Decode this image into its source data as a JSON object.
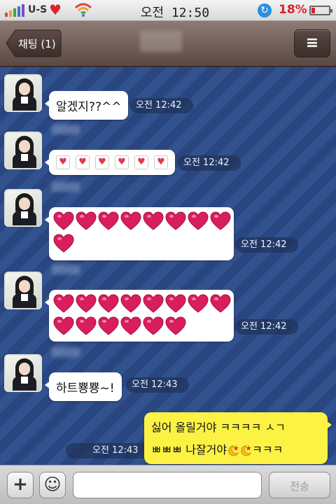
{
  "status_bar": {
    "carrier": "U-S",
    "time": "오전 12:50",
    "battery": "18%"
  },
  "nav": {
    "back_label": "채팅 (1)",
    "title": ""
  },
  "messages": [
    {
      "type": "text",
      "text": "알겠지??^^",
      "time": "오전 12:42"
    },
    {
      "type": "small-hearts",
      "count": 6,
      "time": "오전 12:42"
    },
    {
      "type": "big-hearts",
      "count": 9,
      "time": "오전 12:42"
    },
    {
      "type": "big-hearts",
      "count": 14,
      "time": "오전 12:42"
    },
    {
      "type": "text",
      "text": "하트뿅뿅~!",
      "time": "오전 12:43"
    }
  ],
  "my_message": {
    "line1": "싫어 올릴거야 ㅋㅋㅋㅋ ㅅㄱ",
    "line2_prefix": "ㅃㅃㅃ 나잘거야",
    "line2_suffix": "ㅋㅋㅋ",
    "time": "오전 12:43"
  },
  "input_bar": {
    "placeholder": "",
    "send_label": "전송"
  },
  "colors": {
    "chat_bg": "#31528f",
    "my_bubble": "#fbf244",
    "heart": "#d81f5c"
  }
}
